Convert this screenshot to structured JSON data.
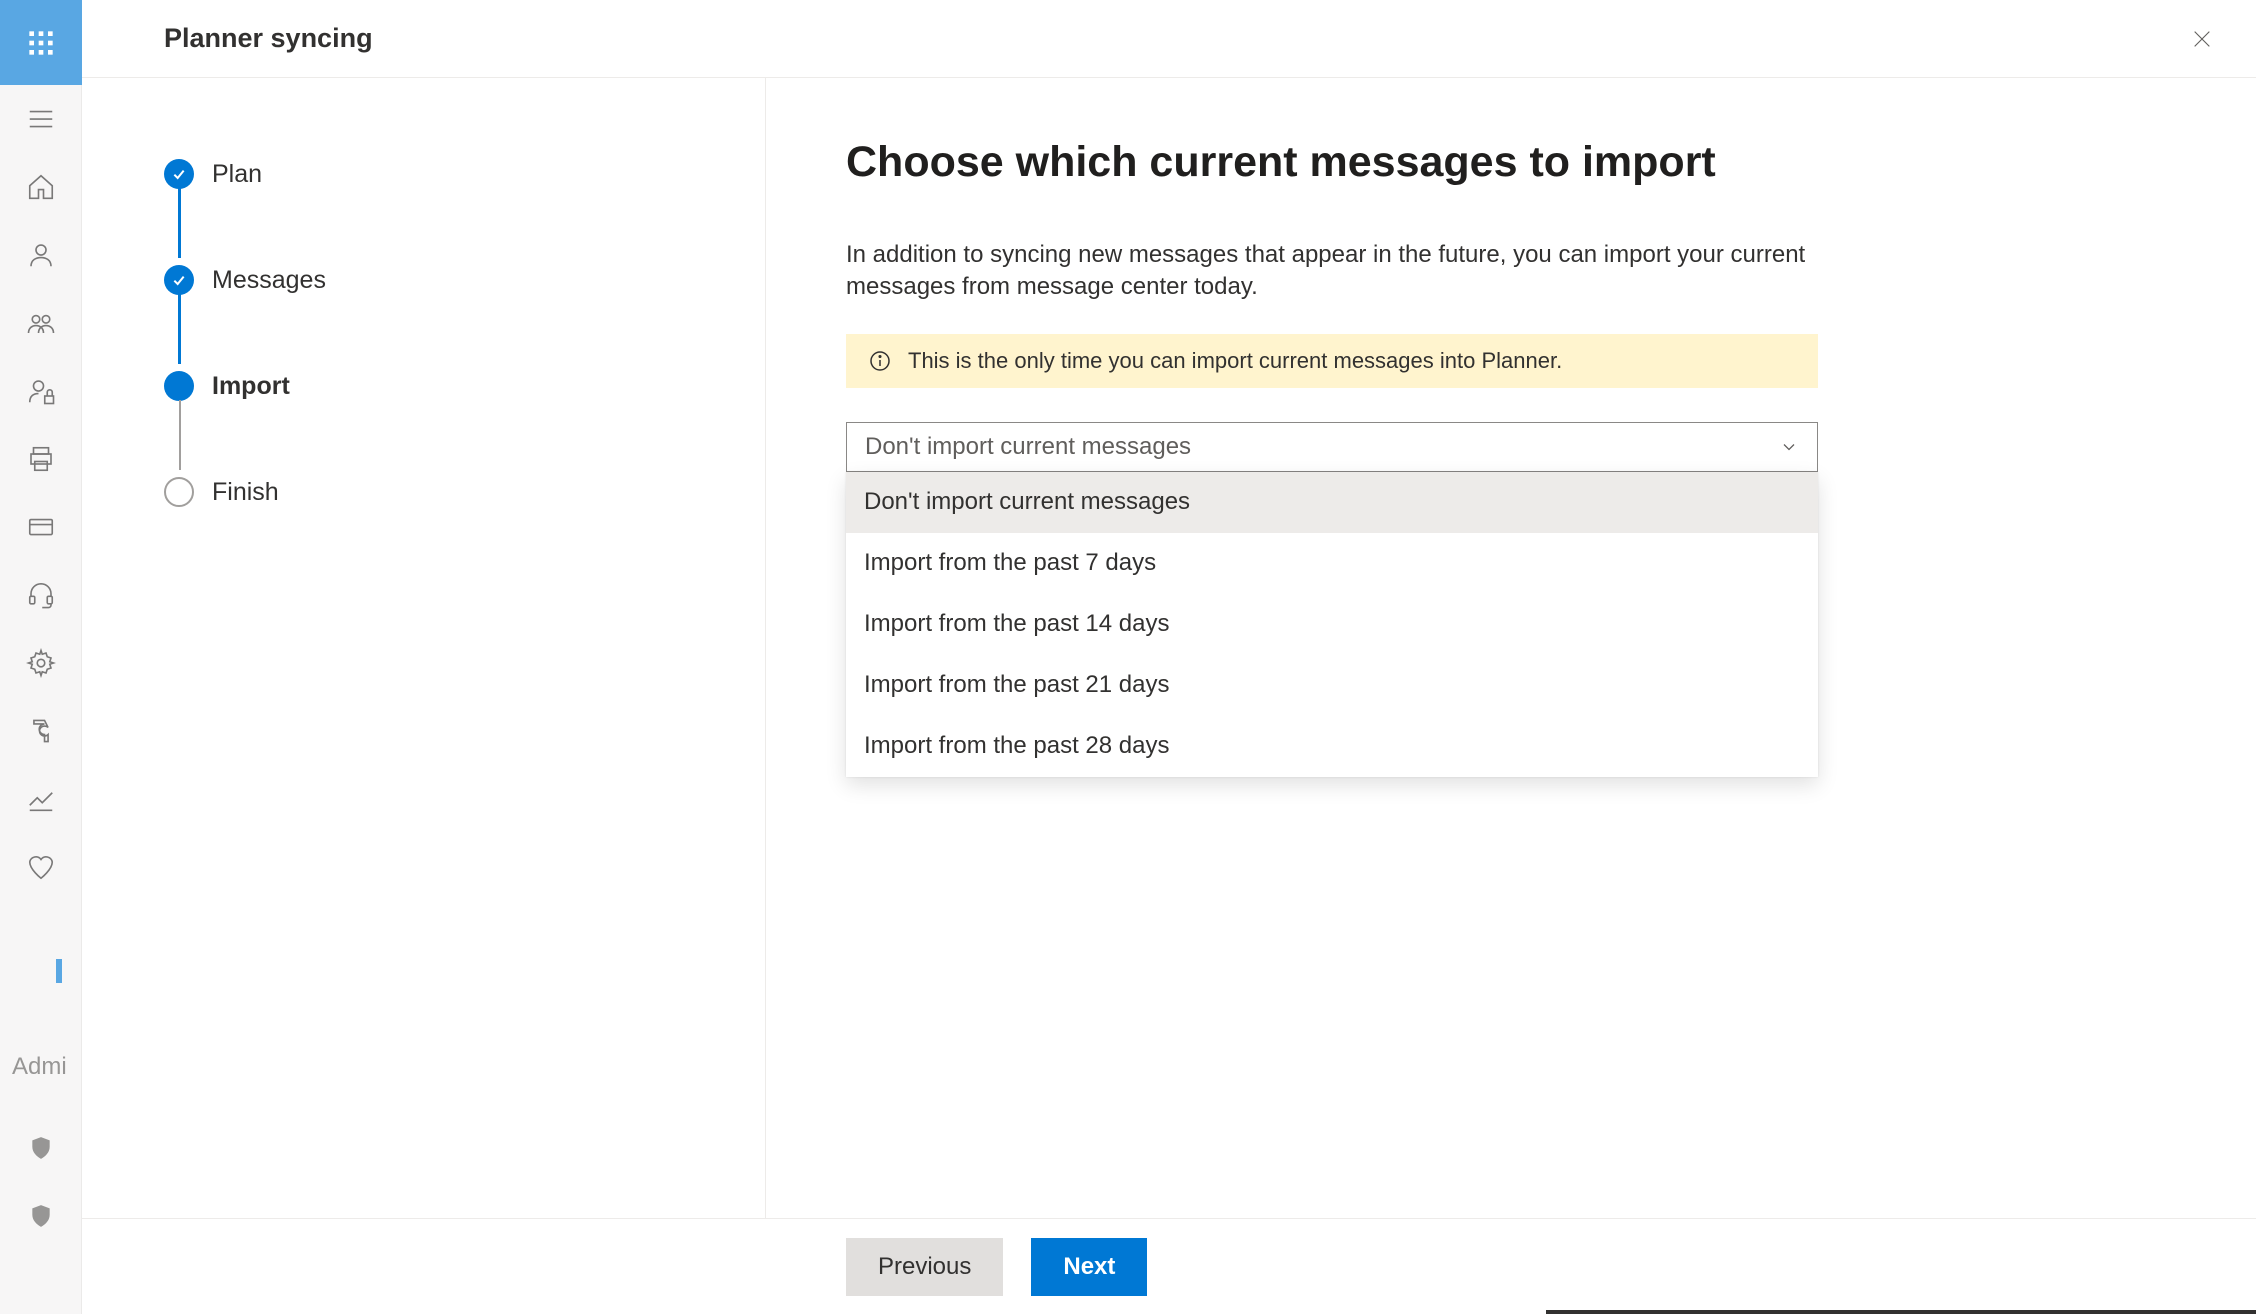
{
  "nav": {
    "admi_label": "Admi"
  },
  "dialog": {
    "title": "Planner syncing"
  },
  "stepper": {
    "steps": [
      {
        "label": "Plan"
      },
      {
        "label": "Messages"
      },
      {
        "label": "Import"
      },
      {
        "label": "Finish"
      }
    ]
  },
  "content": {
    "heading": "Choose which current messages to import",
    "description": "In addition to syncing new messages that appear in the future, you can import your current messages from message center today.",
    "callout": "This is the only time you can import current messages into Planner."
  },
  "dropdown": {
    "selected": "Don't import current messages",
    "options": [
      "Don't import current messages",
      "Import from the past 7 days",
      "Import from the past 14 days",
      "Import from the past 21 days",
      "Import from the past 28 days"
    ]
  },
  "footer": {
    "previous": "Previous",
    "next": "Next"
  }
}
